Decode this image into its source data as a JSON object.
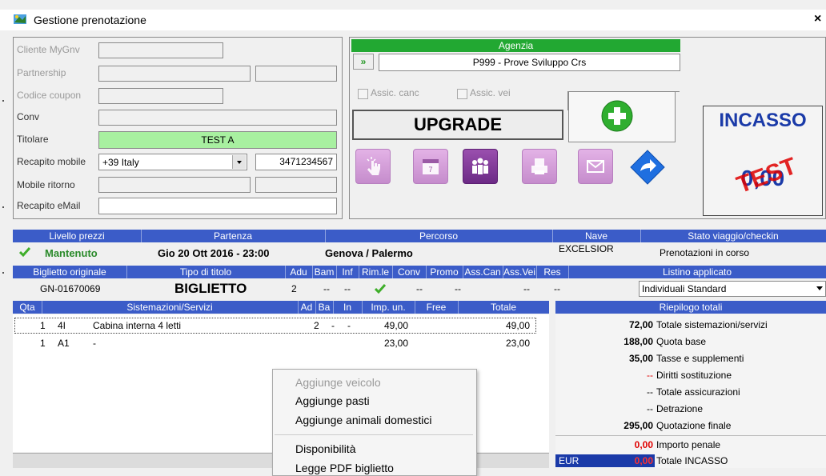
{
  "window": {
    "title": "Gestione prenotazione",
    "close": "×"
  },
  "client": {
    "labels": [
      "Cliente MyGnv",
      "Partnership",
      "Codice coupon",
      "Conv",
      "Titolare",
      "Recapito mobile",
      "Mobile ritorno",
      "Recapito eMail"
    ],
    "titolare_value": "TEST A",
    "mobile_prefix": "+39 Italy",
    "mobile_number": "3471234567"
  },
  "agency": {
    "header": "Agenzia",
    "value": "P999 - Prove Sviluppo Crs",
    "arrow": "»",
    "assic_canc": "Assic. canc",
    "assic_vei": "Assic. vei"
  },
  "upgrade_label": "UPGRADE",
  "incasso": {
    "title": "INCASSO",
    "value": "0,00",
    "stamp": "TEST"
  },
  "trip_header": {
    "livello": "Livello prezzi",
    "partenza": "Partenza",
    "percorso": "Percorso",
    "nave": "Nave",
    "stato": "Stato viaggio/checkin"
  },
  "trip_row": {
    "livello": "Mantenuto",
    "partenza": "Gio 20 Ott 2016 - 23:00",
    "percorso": "Genova / Palermo",
    "nave": "EXCELSIOR",
    "stato": "Prenotazioni in corso"
  },
  "ticket_header": {
    "biglietto": "Biglietto originale",
    "tipo": "Tipo di titolo",
    "adu": "Adu",
    "bam": "Bam",
    "inf": "Inf",
    "rimle": "Rim.le",
    "conv": "Conv",
    "promo": "Promo",
    "asscan": "Ass.Can",
    "assvei": "Ass.Vei",
    "res": "Res",
    "listino": "Listino applicato"
  },
  "ticket_row": {
    "biglietto": "GN-01670069",
    "tipo": "BIGLIETTO",
    "adu": "2",
    "dash": "--",
    "listino": "Individuali Standard"
  },
  "services_header": {
    "qta": "Qta",
    "sistemazioni": "Sistemazioni/Servizi",
    "ad": "Ad",
    "ba": "Ba",
    "in": "In",
    "imp": "Imp. un.",
    "free": "Free",
    "totale": "Totale"
  },
  "services": [
    {
      "qta": "1",
      "code": "4I",
      "desc": "Cabina interna 4 letti",
      "ad": "2",
      "ba": "-",
      "in": "-",
      "imp": "49,00",
      "totale": "49,00"
    },
    {
      "qta": "1",
      "code": "A1",
      "desc": "-",
      "ad": "",
      "ba": "",
      "in": "",
      "imp": "23,00",
      "totale": "23,00"
    }
  ],
  "summary": {
    "header": "Riepilogo totali",
    "rows": [
      {
        "value": "72,00",
        "label": "Totale sistemazioni/servizi"
      },
      {
        "value": "188,00",
        "label": "Quota base"
      },
      {
        "value": "35,00",
        "label": "Tasse e supplementi"
      },
      {
        "value": "--",
        "label": "Diritti sostituzione"
      },
      {
        "value": "--",
        "label": "Totale assicurazioni"
      },
      {
        "value": "--",
        "label": "Detrazione"
      },
      {
        "value": "295,00",
        "label": "Quotazione finale"
      }
    ],
    "penale": {
      "value": "0,00",
      "label": "Importo penale"
    },
    "currency": "EUR",
    "incasso_total": {
      "value": "0,00",
      "label": "Totale INCASSO"
    }
  },
  "context_menu": [
    "Aggiunge veicolo",
    "Aggiunge pasti",
    "Aggiunge animali domestici",
    "Disponibilità",
    "Legge PDF biglietto"
  ],
  "colors": {
    "accent_blue": "#3b5cc8",
    "agency_green": "#22a832",
    "incasso_blue": "#1a3aa8",
    "penale_red": "#e00000"
  }
}
